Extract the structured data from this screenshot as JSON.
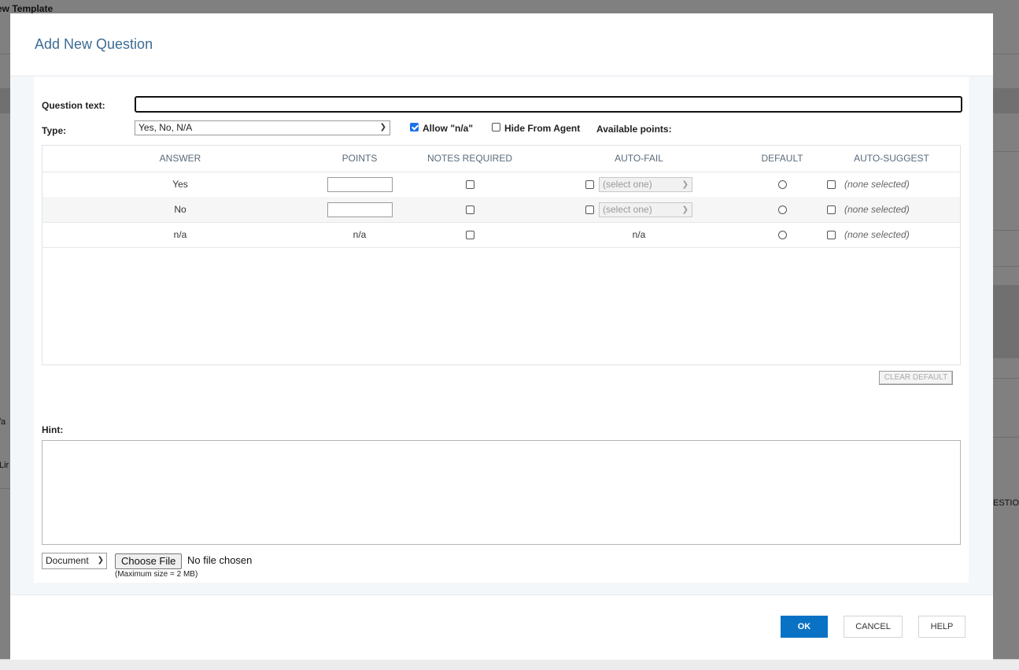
{
  "background": {
    "page_title": "ew Template",
    "fragments": [
      "/a",
      "Lir",
      "ESTION"
    ]
  },
  "dialog": {
    "title": "Add New Question",
    "question_text_label": "Question text:",
    "question_text_value": "",
    "type_label": "Type:",
    "type_value": "Yes, No, N/A",
    "allow_na_label": "Allow \"n/a\"",
    "allow_na_checked": true,
    "hide_from_agent_label": "Hide From Agent",
    "hide_from_agent_checked": false,
    "available_points_label": "Available points:",
    "table": {
      "headers": [
        "ANSWER",
        "POINTS",
        "NOTES REQUIRED",
        "AUTO-FAIL",
        "DEFAULT",
        "AUTO-SUGGEST"
      ],
      "rows": [
        {
          "answer": "Yes",
          "points": "",
          "autofail_select": "(select one)",
          "suggest": "(none selected)"
        },
        {
          "answer": "No",
          "points": "",
          "autofail_select": "(select one)",
          "suggest": "(none selected)"
        },
        {
          "answer": "n/a",
          "points": "n/a",
          "autofail": "n/a",
          "suggest": "(none selected)"
        }
      ]
    },
    "clear_default_label": "CLEAR DEFAULT",
    "hint_label": "Hint:",
    "hint_value": "",
    "attachment_type": "Document",
    "choose_file_label": "Choose File",
    "file_status": "No file chosen",
    "max_size_note": "(Maximum size = 2 MB)",
    "buttons": {
      "ok": "OK",
      "cancel": "CANCEL",
      "help": "HELP"
    }
  }
}
